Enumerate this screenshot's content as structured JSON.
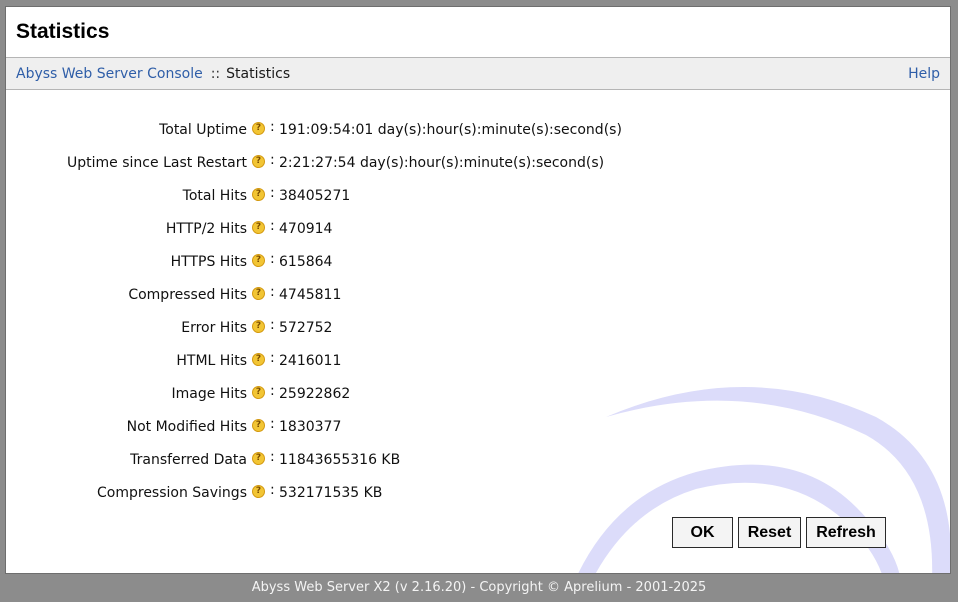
{
  "page": {
    "title": "Statistics"
  },
  "nav": {
    "console_link": "Abyss Web Server Console",
    "separator": "::",
    "current": "Statistics",
    "help": "Help"
  },
  "stats": [
    {
      "label": "Total Uptime",
      "value": "191:09:54:01 day(s):hour(s):minute(s):second(s)"
    },
    {
      "label": "Uptime since Last Restart",
      "value": "2:21:27:54 day(s):hour(s):minute(s):second(s)"
    },
    {
      "label": "Total Hits",
      "value": "38405271"
    },
    {
      "label": "HTTP/2 Hits",
      "value": "470914"
    },
    {
      "label": "HTTPS Hits",
      "value": "615864"
    },
    {
      "label": "Compressed Hits",
      "value": "4745811"
    },
    {
      "label": "Error Hits",
      "value": "572752"
    },
    {
      "label": "HTML Hits",
      "value": "2416011"
    },
    {
      "label": "Image Hits",
      "value": "25922862"
    },
    {
      "label": "Not Modified Hits",
      "value": "1830377"
    },
    {
      "label": "Transferred Data",
      "value": "11843655316 KB"
    },
    {
      "label": "Compression Savings",
      "value": "532171535 KB"
    }
  ],
  "help_icon_glyph": "?",
  "colon": ":",
  "buttons": {
    "ok": "OK",
    "reset": "Reset",
    "refresh": "Refresh"
  },
  "footer": {
    "text": "Abyss Web Server X2 (v 2.16.20) - Copyright © Aprelium - 2001-2025"
  },
  "colors": {
    "link": "#2f5ea8",
    "background": "#8c8c8c",
    "swirl": "#dcdcfa",
    "help_icon": "#f2c534"
  }
}
